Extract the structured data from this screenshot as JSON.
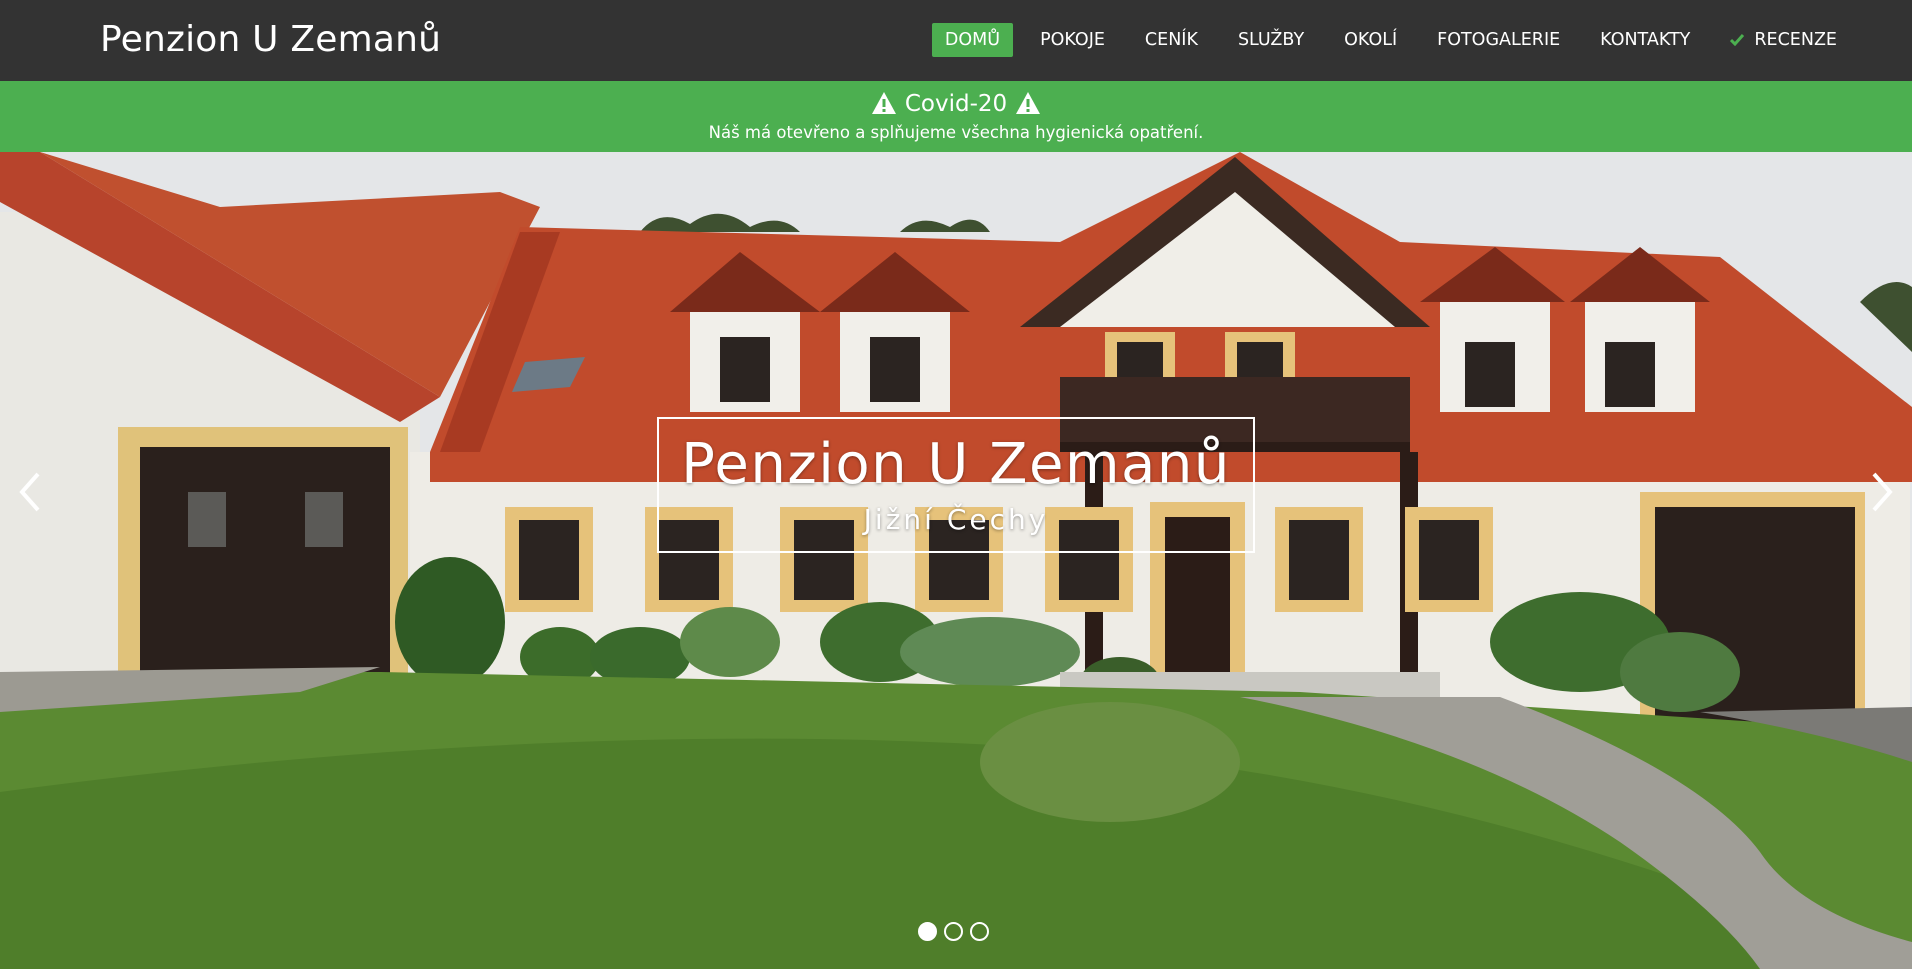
{
  "header": {
    "brand": "Penzion U Zemanů",
    "nav": [
      {
        "label": "DOMŮ",
        "active": true
      },
      {
        "label": "POKOJE"
      },
      {
        "label": "CENÍK"
      },
      {
        "label": "SLUŽBY"
      },
      {
        "label": "OKOLÍ"
      },
      {
        "label": "FOTOGALERIE"
      },
      {
        "label": "KONTAKTY"
      },
      {
        "label": "RECENZE",
        "icon": "check-icon"
      }
    ]
  },
  "banner": {
    "title": "Covid-20",
    "text": "Náš má otevřeno a splňujeme všechna hygienická opatření.",
    "icon": "warning-icon",
    "color": "#4caf50"
  },
  "hero": {
    "title": "Penzion U Zemanů",
    "subtitle": "Jižní Čechy",
    "slides_count": 3,
    "active_slide": 1,
    "prev_icon": "chevron-left-icon",
    "next_icon": "chevron-right-icon"
  },
  "colors": {
    "navbar": "#333333",
    "accent": "#4caf50"
  }
}
